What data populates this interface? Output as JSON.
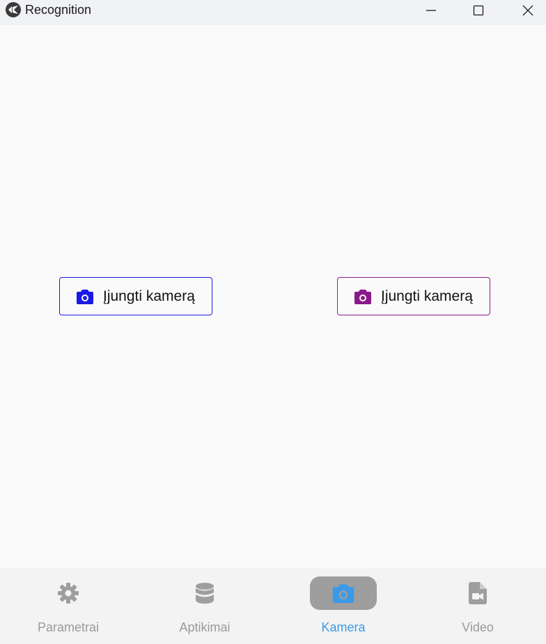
{
  "window": {
    "title": "Recognition",
    "app_icon": "kivy-logo-icon",
    "controls": [
      "minimize-icon",
      "maximize-icon",
      "close-icon"
    ]
  },
  "main": {
    "buttons": [
      {
        "label": "Įjungti kamerą",
        "icon": "camera-icon",
        "color": "#1a1ae6"
      },
      {
        "label": "Įjungti kamerą",
        "icon": "camera-icon",
        "color": "#8a1a8a"
      }
    ]
  },
  "nav": {
    "items": [
      {
        "label": "Parametrai",
        "icon": "gear-icon",
        "active": false
      },
      {
        "label": "Aptikimai",
        "icon": "database-icon",
        "active": false
      },
      {
        "label": "Kamera",
        "icon": "camera-icon",
        "active": true
      },
      {
        "label": "Video",
        "icon": "video-file-icon",
        "active": false
      }
    ],
    "active_color": "#3b9ae8",
    "inactive_color": "#9a9a9a"
  }
}
